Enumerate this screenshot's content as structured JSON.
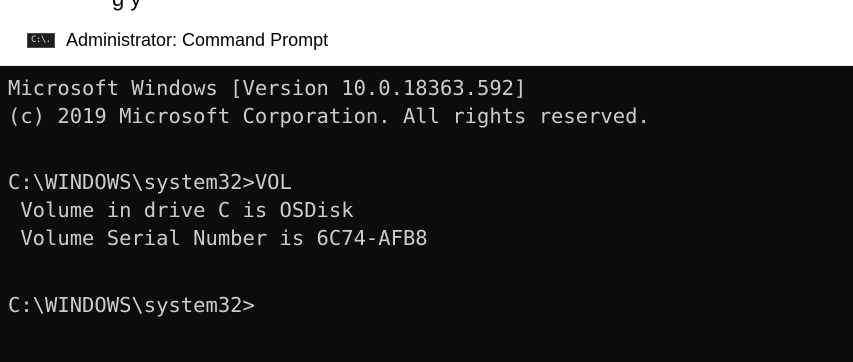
{
  "page": {
    "above_window_text": "g y"
  },
  "window": {
    "icon_label": "C:\\.",
    "icon": "cmd-console-icon",
    "title": "Administrator: Command Prompt"
  },
  "console": {
    "background": "#0c0c0c",
    "text_color": "#cccccc",
    "lines": [
      "Microsoft Windows [Version 10.0.18363.592]",
      "(c) 2019 Microsoft Corporation. All rights reserved.",
      "",
      "C:\\WINDOWS\\system32>VOL",
      " Volume in drive C is OSDisk",
      " Volume Serial Number is 6C74-AFB8",
      "",
      "C:\\WINDOWS\\system32>"
    ]
  }
}
